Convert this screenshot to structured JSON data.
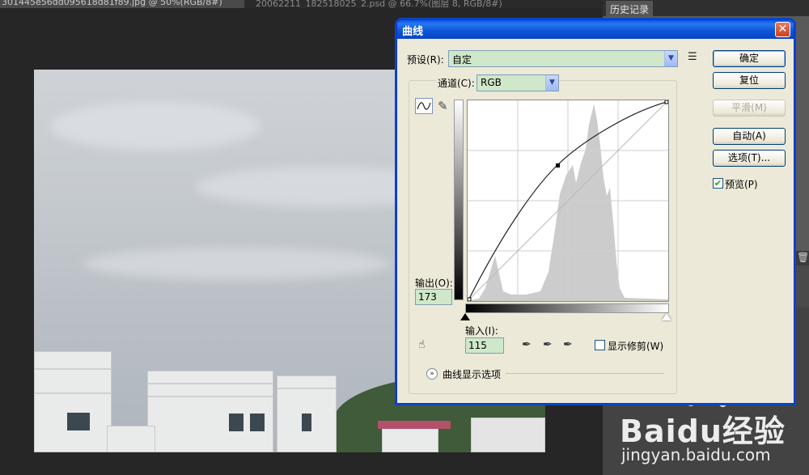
{
  "app": {
    "doc_tabs": [
      "301445e56dd095618d81f89.jpg @ 50%(RGB/8#)",
      "20062211_182518025_2.psd @ 66.7%(图层 8, RGB/8#)"
    ],
    "panel_tab": "历史记录"
  },
  "dialog": {
    "title": "曲线",
    "close_icon": "close-icon",
    "preset_label": "预设(R):",
    "preset_value": "自定",
    "channel_label": "通道(C):",
    "channel_value": "RGB",
    "output_label": "输出(O):",
    "output_value": "173",
    "input_label": "输入(I):",
    "input_value": "115",
    "show_clipping_label": "显示修剪(W)",
    "display_options_label": "曲线显示选项",
    "preview_label": "预览(P)",
    "preview_checked": true,
    "buttons": {
      "ok": "确定",
      "reset": "复位",
      "smooth": "平滑(M)",
      "auto": "自动(A)",
      "options": "选项(T)..."
    }
  },
  "watermark": {
    "brand": "Baidu经验",
    "url": "jingyan.baidu.com"
  },
  "colors": {
    "dialog_bg": "#ece9d8",
    "title_bar": "#0a58e8",
    "field_bg": "#cfe8c9",
    "histogram": "#cccccc"
  }
}
